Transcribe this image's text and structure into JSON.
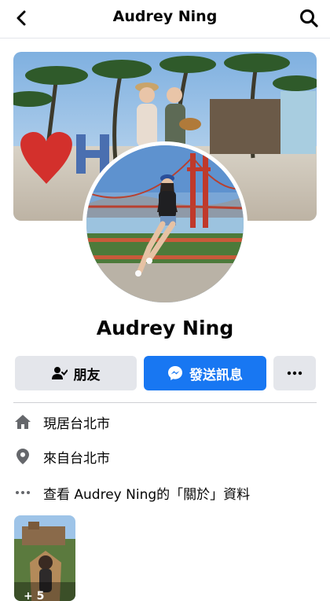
{
  "header": {
    "title": "Audrey Ning",
    "back_icon": "chevron-left-icon",
    "search_icon": "search-icon"
  },
  "profile": {
    "name": "Audrey Ning"
  },
  "actions": {
    "friends_label": "朋友",
    "message_label": "發送訊息",
    "more_icon": "more-dots-icon",
    "accent": "#1877f2"
  },
  "details": [
    {
      "icon": "home-icon",
      "text": "現居台北市"
    },
    {
      "icon": "location-pin-icon",
      "text": "來自台北市"
    },
    {
      "icon": "more-dots-icon",
      "text": "查看 Audrey Ning的「關於」資料"
    }
  ],
  "photos": {
    "more_count": "+ 5"
  }
}
